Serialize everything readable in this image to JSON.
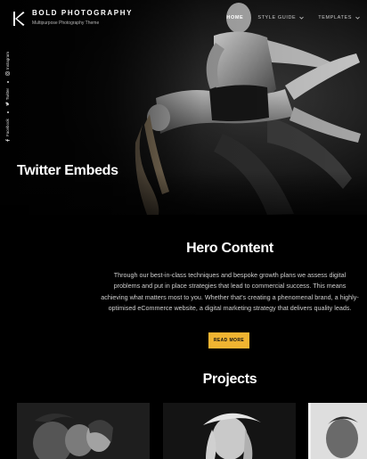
{
  "brand": {
    "title": "BOLD PHOTOGRAPHY",
    "subtitle": "Multipurpose Photography Theme",
    "logo_icon": "k-logo-icon"
  },
  "nav": {
    "items": [
      {
        "label": "HOME",
        "active": true
      },
      {
        "label": "STYLE GUIDE",
        "has_dropdown": true
      },
      {
        "label": "TEMPLATES",
        "has_dropdown": true
      }
    ]
  },
  "social": {
    "items": [
      {
        "label": "Facebook",
        "icon": "facebook-icon"
      },
      {
        "label": "Twitter",
        "icon": "twitter-icon"
      },
      {
        "label": "Instagram",
        "icon": "instagram-icon"
      }
    ]
  },
  "hero": {
    "title": "Twitter Embeds"
  },
  "content": {
    "title": "Hero Content",
    "body": "Through our best-in-class techniques and bespoke growth plans we assess digital problems and put in place strategies that lead to commercial success. This means achieving what matters most to you. Whether that’s creating a phenomenal brand, a highly-optimised eCommerce website, a digital marketing strategy that delivers quality leads.",
    "button_label": "READ MORE"
  },
  "projects": {
    "title": "Projects"
  },
  "colors": {
    "accent": "#f0b431",
    "background": "#000000",
    "text": "#ffffff"
  }
}
